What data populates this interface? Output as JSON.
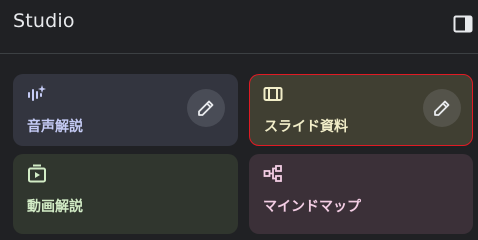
{
  "header": {
    "title": "Studio",
    "toggle_icon": "side-panel-toggle-icon"
  },
  "cards": [
    {
      "label": "音声解説",
      "icon": "audio-sparkle-icon",
      "color": "#c5cbf5",
      "background": "#33353f",
      "edit_icon": "pencil-icon"
    },
    {
      "label": "スライド資料",
      "icon": "slides-icon",
      "color": "#f1edc8",
      "background": "#403f32",
      "selected_outline_color": "#e01b24",
      "edit_icon": "pencil-icon"
    },
    {
      "label": "動画解説",
      "icon": "video-icon",
      "color": "#d2ecc6",
      "background": "#30362e"
    },
    {
      "label": "マインドマップ",
      "icon": "mind-map-icon",
      "color": "#f3cde4",
      "background": "#3b3038"
    }
  ]
}
